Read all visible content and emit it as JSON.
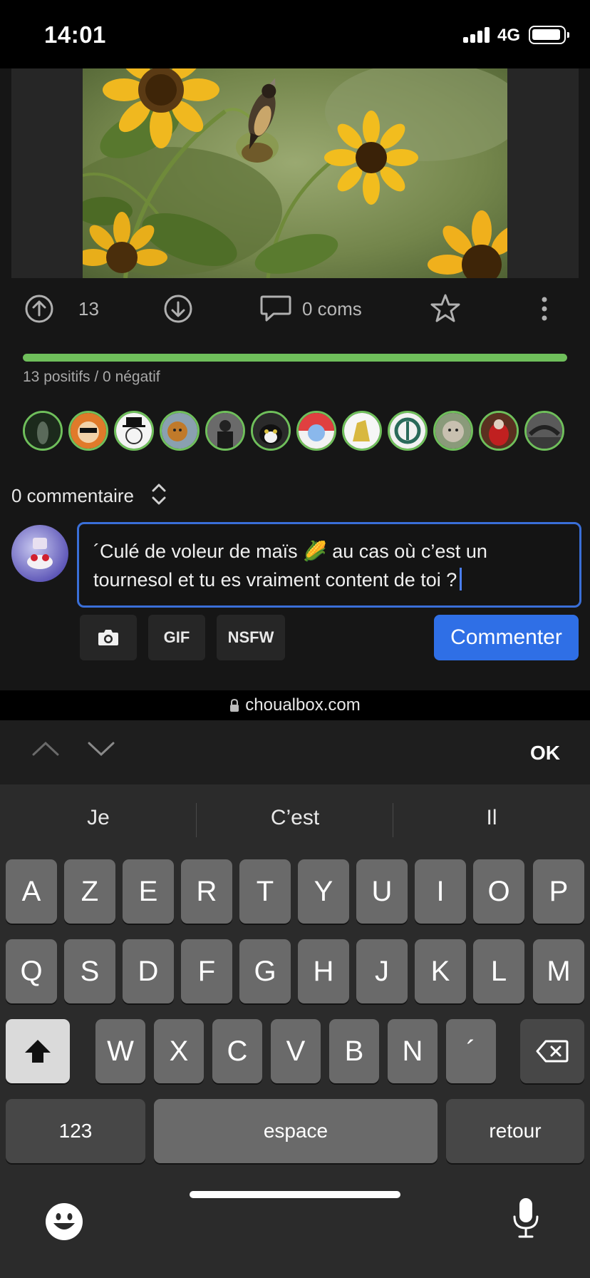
{
  "status_bar": {
    "time": "14:01",
    "network": "4G"
  },
  "post": {
    "upvotes": "13",
    "comments_label": "0 coms",
    "vote_summary": "13 positifs / 0 négatif",
    "vote_ratio": 1.0,
    "voter_count": 12
  },
  "comments": {
    "title": "0 commentaire",
    "draft": "´Culé de voleur de maïs 🌽 au cas où c’est un tournesol et tu es vraiment content de toi ?",
    "buttons": {
      "gif": "GIF",
      "nsfw": "NSFW",
      "submit": "Commenter"
    }
  },
  "browser": {
    "url": "choualbox.com"
  },
  "keyboard": {
    "toolbar_ok": "OK",
    "suggestions": [
      "Je",
      "C’est",
      "Il"
    ],
    "row1": [
      "A",
      "Z",
      "E",
      "R",
      "T",
      "Y",
      "U",
      "I",
      "O",
      "P"
    ],
    "row2": [
      "Q",
      "S",
      "D",
      "F",
      "G",
      "H",
      "J",
      "K",
      "L",
      "M"
    ],
    "row3": [
      "W",
      "X",
      "C",
      "V",
      "B",
      "N",
      "´"
    ],
    "numbers_key": "123",
    "space_key": "espace",
    "return_key": "retour"
  },
  "colors": {
    "accent": "#2f6fe6",
    "vote_green": "#6fbf5b",
    "input_border": "#3a6fd8"
  }
}
